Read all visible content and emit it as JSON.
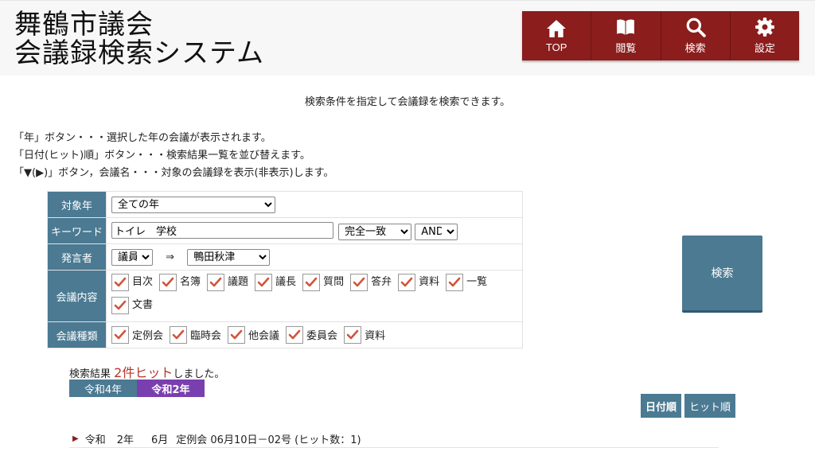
{
  "site": {
    "title_line1": "舞鶴市議会",
    "title_line2": "会議録検索システム"
  },
  "nav": {
    "items": [
      {
        "label": "TOP",
        "icon": "home-icon"
      },
      {
        "label": "閲覧",
        "icon": "book-icon"
      },
      {
        "label": "検索",
        "icon": "search-icon"
      },
      {
        "label": "設定",
        "icon": "gear-icon"
      }
    ]
  },
  "intro": "検索条件を指定して会議録を検索できます。",
  "help": [
    "「年」ボタン・・・選択した年の会議が表示されます。",
    "「日付(ヒット)順」ボタン・・・検索結果一覧を並び替えます。",
    "「▼(▶)」ボタン，会議名・・・対象の会議録を表示(非表示)します。"
  ],
  "form": {
    "year": {
      "label": "対象年",
      "value": "全ての年"
    },
    "keyword": {
      "label": "キーワード",
      "value": "トイレ　学校",
      "match": "完全一致",
      "logic": "AND"
    },
    "speaker": {
      "label": "発言者",
      "type": "議員",
      "arrow": "⇒",
      "name": "鴨田秋津"
    },
    "content": {
      "label": "会議内容",
      "items": [
        "目次",
        "名簿",
        "議題",
        "議長",
        "質問",
        "答弁",
        "資料",
        "一覧",
        "文書"
      ]
    },
    "kind": {
      "label": "会議種類",
      "items": [
        "定例会",
        "臨時会",
        "他会議",
        "委員会",
        "資料"
      ]
    }
  },
  "search_button": "検索",
  "result": {
    "prefix": "検索結果",
    "hit": "2件ヒット",
    "suffix": "しました。"
  },
  "years": [
    {
      "label": "令和4年",
      "color": "#4b7a92",
      "selected": false
    },
    {
      "label": "令和2年",
      "color": "#7a3fae",
      "selected": true
    }
  ],
  "sort": {
    "date": "日付順",
    "hit": "ヒット順"
  },
  "results": [
    {
      "era": "令和",
      "year": "2年",
      "month": "6月",
      "text": "定例会 06月10日－02号 (ヒット数：1)"
    }
  ],
  "colors": {
    "nav_bg": "#8b1d1d",
    "label_bg": "#4b7a92",
    "check": "#d0553c",
    "hit_text": "#b5352a"
  }
}
